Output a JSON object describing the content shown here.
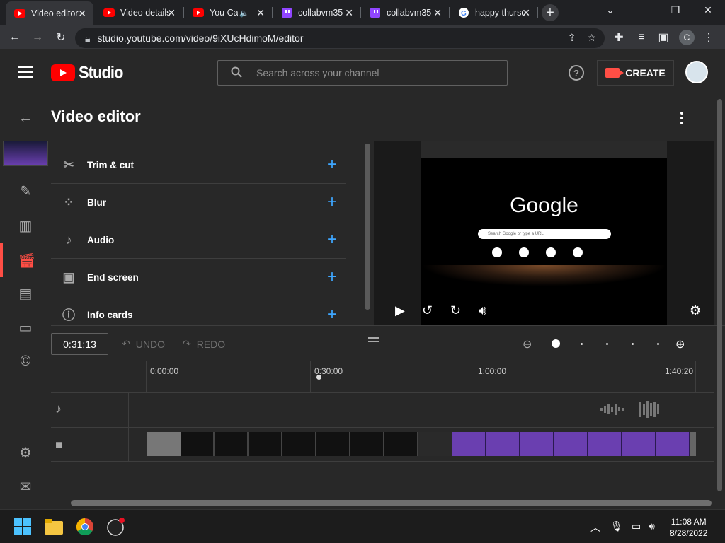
{
  "browser": {
    "tabs": [
      {
        "title": "Video editor",
        "favicon": "youtube-icon",
        "active": true
      },
      {
        "title": "Video details",
        "favicon": "youtube-icon",
        "active": false
      },
      {
        "title": "You Can",
        "favicon": "youtube-icon",
        "active": false,
        "audio": true
      },
      {
        "title": "collabvm35",
        "favicon": "twitch-icon",
        "active": false
      },
      {
        "title": "collabvm35",
        "favicon": "twitch-icon",
        "active": false
      },
      {
        "title": "happy thursday",
        "favicon": "google-icon",
        "active": false
      }
    ],
    "url": "studio.youtube.com/video/9iXUcHdimoM/editor",
    "profile_initial": "C"
  },
  "header": {
    "studio_label": "Studio",
    "search_placeholder": "Search across your channel",
    "help_label": "?",
    "create_label": "CREATE"
  },
  "main": {
    "title": "Video editor",
    "tools": [
      {
        "label": "Trim & cut",
        "icon": "scissors-icon"
      },
      {
        "label": "Blur",
        "icon": "blur-icon"
      },
      {
        "label": "Audio",
        "icon": "music-note-icon"
      },
      {
        "label": "End screen",
        "icon": "end-screen-icon"
      },
      {
        "label": "Info cards",
        "icon": "info-icon"
      }
    ],
    "preview": {
      "google_text": "Google",
      "search_text": "Search Google or type a URL"
    }
  },
  "editor": {
    "timecode": "0:31:13",
    "undo_label": "UNDO",
    "redo_label": "REDO",
    "ruler": [
      "0:00:00",
      "0:30:00",
      "1:00:00",
      "1:40:20"
    ]
  },
  "taskbar": {
    "time": "11:08 AM",
    "date": "8/28/2022"
  },
  "colors": {
    "accent_red": "#ff0000",
    "active_sidebar": "#ff4e45",
    "link_blue": "#3ea6ff",
    "background": "#282828"
  }
}
